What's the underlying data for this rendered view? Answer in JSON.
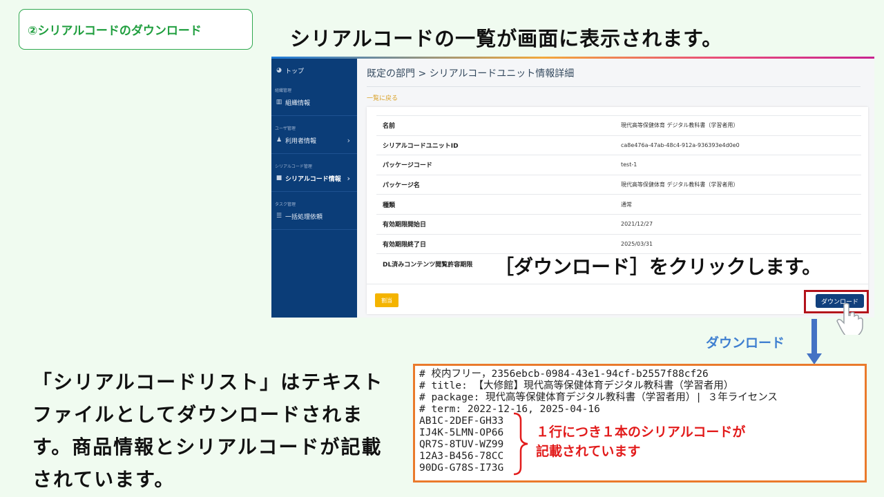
{
  "step_badge": "②シリアルコードのダウンロード",
  "headline": "シリアルコードの一覧が画面に表示されます。",
  "sidebar": {
    "top": "トップ",
    "group_org": "組織管理",
    "org_info": "組織情報",
    "group_user": "ユーザ管理",
    "user_info": "利用者情報",
    "group_serial": "シリアルコード管理",
    "serial_info": "シリアルコード情報",
    "group_task": "タスク管理",
    "batch": "一括処理依頼"
  },
  "main": {
    "breadcrumb": "既定の部門 > シリアルコードユニット情報詳細",
    "back_link": "一覧に戻る",
    "rows": [
      {
        "key": "名前",
        "value": "現代高等保健体育 デジタル教科書（学習者用）"
      },
      {
        "key": "シリアルコードユニットID",
        "value": "ca8e476a-47ab-48c4-912a-936393e4d0e0"
      },
      {
        "key": "パッケージコード",
        "value": "test-1"
      },
      {
        "key": "パッケージ名",
        "value": "現代高等保健体育 デジタル教科書（学習者用）"
      },
      {
        "key": "種類",
        "value": "通常"
      },
      {
        "key": "有効期限開始日",
        "value": "2021/12/27"
      },
      {
        "key": "有効期限終了日",
        "value": "2025/03/31"
      },
      {
        "key": "DL済みコンテンツ閲覧許容期限",
        "value": ""
      }
    ],
    "assign_label": "割当",
    "download_label": "ダウンロード"
  },
  "instruction": "［ダウンロード］をクリックします。",
  "download_caption": "ダウンロード",
  "description": "「シリアルコードリスト」はテキストファイルとしてダウンロードされます。商品情報とシリアルコードが記載されています。",
  "file_lines": [
    "# 校内フリー，2356ebcb-0984-43e1-94cf-b2557f88cf26",
    "# title: 【大修館】現代高等保健体育デジタル教科書（学習者用）",
    "# package: 現代高等保健体育デジタル教科書（学習者用）| ３年ライセンス",
    "# term: 2022-12-16, 2025-04-16",
    "AB1C-2DEF-GH33",
    "IJ4K-5LMN-OP66",
    "QR7S-8TUV-WZ99",
    "12A3-B456-78CC",
    "90DG-G78S-I73G"
  ],
  "note": {
    "line1": "１行につき１本のシリアルコードが",
    "line2": "記載されています"
  },
  "colors": {
    "sidebar": "#0b3d78",
    "badge_green": "#1f9e3e",
    "highlight_red": "#b3121b",
    "file_border": "#ea7a2c",
    "note_red": "#e21b1b",
    "caption_blue": "#3f7fd0"
  }
}
